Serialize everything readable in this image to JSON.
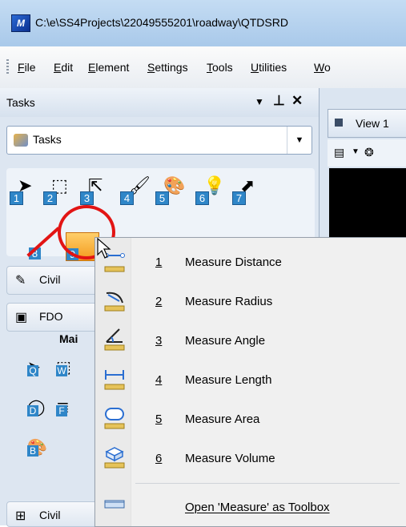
{
  "window": {
    "title": "C:\\e\\SS4Projects\\22049555201\\roadway\\QTDSRD"
  },
  "menubar": {
    "items": [
      {
        "label": "File",
        "u": "F",
        "rest": "ile"
      },
      {
        "label": "Edit",
        "u": "E",
        "rest": "dit"
      },
      {
        "label": "Element",
        "u": "E",
        "rest": "lement"
      },
      {
        "label": "Settings",
        "u": "S",
        "rest": "ettings"
      },
      {
        "label": "Tools",
        "u": "T",
        "rest": "ools"
      },
      {
        "label": "Utilities",
        "u": "U",
        "rest": "tilities"
      },
      {
        "label": "Wo",
        "u": "W",
        "rest": "o"
      }
    ]
  },
  "tasks_panel": {
    "title": "Tasks",
    "dropdown_value": "Tasks",
    "tool_numbers": [
      "1",
      "2",
      "3",
      "4",
      "5",
      "6",
      "7",
      "8",
      "9"
    ],
    "sections": [
      "Civil",
      "FDO"
    ],
    "main_title": "Mai",
    "sub_numbers": [
      "Q",
      "W",
      "D",
      "F",
      "B"
    ],
    "bottom_section": "Civil"
  },
  "view": {
    "tab_label": "View 1"
  },
  "context_menu": {
    "items": [
      {
        "accel": "1",
        "label": "Measure Distance"
      },
      {
        "accel": "2",
        "label": "Measure Radius"
      },
      {
        "accel": "3",
        "label": "Measure Angle"
      },
      {
        "accel": "4",
        "label": "Measure Length"
      },
      {
        "accel": "5",
        "label": "Measure Area"
      },
      {
        "accel": "6",
        "label": "Measure Volume"
      }
    ],
    "toolbox_item": "Open 'Measure' as Toolbox"
  }
}
